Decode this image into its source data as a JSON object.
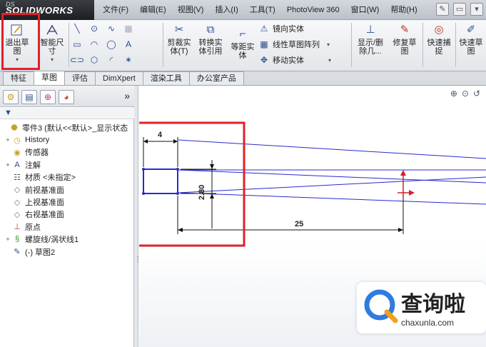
{
  "app": {
    "logo": "SOLIDWORKS",
    "logo_prefix": "DS"
  },
  "menu": [
    "文件(F)",
    "编辑(E)",
    "视图(V)",
    "插入(I)",
    "工具(T)",
    "PhotoView 360",
    "窗口(W)",
    "帮助(H)"
  ],
  "ribbon": {
    "exit_sketch": "退出草\n图",
    "smart_dimension": "智能尺\n寸",
    "trim": "剪裁实\n体(T)",
    "convert": "转换实\n体引用",
    "offset": "等距实\n体",
    "mirror": "镜向实体",
    "linear_pattern": "线性草图阵列",
    "move": "移动实体",
    "show_delete": "显示/删\n除几...",
    "repair": "修复草\n图",
    "quick_snap": "快速捕\n捉",
    "rapid_sketch": "快速草\n图"
  },
  "tabs": [
    "特征",
    "草图",
    "评估",
    "DimXpert",
    "渲染工具",
    "办公室产品"
  ],
  "active_tab": "草图",
  "panel": {
    "more": "»",
    "tree": [
      {
        "label": "零件3  (默认<<默认>_显示状态",
        "icon": "part-icon",
        "exp": ""
      },
      {
        "label": "History",
        "icon": "history-icon",
        "exp": "+"
      },
      {
        "label": "传感器",
        "icon": "sensor-icon",
        "exp": ""
      },
      {
        "label": "注解",
        "icon": "annotation-icon",
        "exp": "+"
      },
      {
        "label": "材质 <未指定>",
        "icon": "material-icon",
        "exp": ""
      },
      {
        "label": "前视基准面",
        "icon": "plane-icon",
        "exp": ""
      },
      {
        "label": "上视基准面",
        "icon": "plane-icon",
        "exp": ""
      },
      {
        "label": "右视基准面",
        "icon": "plane-icon",
        "exp": ""
      },
      {
        "label": "原点",
        "icon": "origin-icon",
        "exp": ""
      },
      {
        "label": "螺旋线/涡状线1",
        "icon": "helix-icon",
        "exp": "+"
      },
      {
        "label": "(-) 草图2",
        "icon": "sketch-icon",
        "exp": ""
      }
    ]
  },
  "viewport": {
    "dim_width": "4",
    "dim_height": "2.80",
    "dim_length": "25"
  },
  "watermark": {
    "title": "查询啦",
    "url": "chaxunla.com"
  },
  "colors": {
    "highlight": "#e0202a",
    "sketch_line": "#2a2ad0",
    "dimension": "#111111"
  }
}
